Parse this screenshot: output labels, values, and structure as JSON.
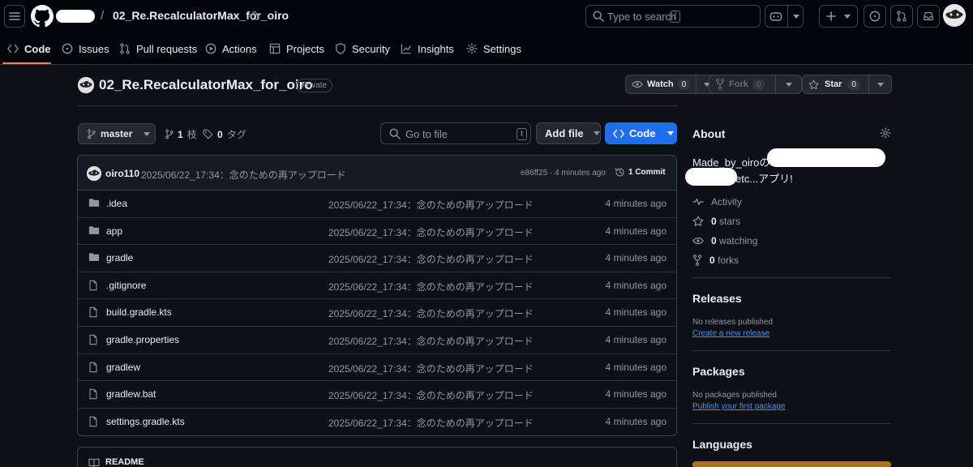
{
  "header": {
    "repo_crumb": "02_Re.RecalculatorMax_for_oiro",
    "separator": "/",
    "search_placeholder": "Type to search",
    "search_shortcut": "/"
  },
  "nav_tabs": [
    {
      "label": "Code",
      "icon": "code-icon",
      "active": true
    },
    {
      "label": "Issues",
      "icon": "issue-opened-icon"
    },
    {
      "label": "Pull requests",
      "icon": "git-pull-request-icon"
    },
    {
      "label": "Actions",
      "icon": "play-icon"
    },
    {
      "label": "Projects",
      "icon": "table-icon"
    },
    {
      "label": "Security",
      "icon": "shield-icon"
    },
    {
      "label": "Insights",
      "icon": "graph-icon"
    },
    {
      "label": "Settings",
      "icon": "gear-icon"
    }
  ],
  "repo": {
    "name": "02_Re.RecalculatorMax_for_oiro",
    "visibility": "Private",
    "watch": {
      "label": "Watch",
      "count": "0"
    },
    "fork": {
      "label": "Fork",
      "count": "0"
    },
    "star": {
      "label": "Star",
      "count": "0"
    }
  },
  "toolbar": {
    "branch": "master",
    "branches_count": "1",
    "branches_label": "枝",
    "tags_count": "0",
    "tags_label": "タグ",
    "goto_placeholder": "Go to file",
    "goto_shortcut": "t",
    "add_file": "Add file",
    "code": "Code"
  },
  "latest_commit": {
    "author": "oiro110",
    "message": "2025/06/22_17:34：念のための再アップロード",
    "hash_time": "e86ff25 · 4 minutes ago",
    "commits": "1 Commit"
  },
  "files": [
    {
      "name": ".idea",
      "type": "folder",
      "message": "2025/06/22_17:34：念のための再アップロード",
      "time": "4 minutes ago"
    },
    {
      "name": "app",
      "type": "folder",
      "message": "2025/06/22_17:34：念のための再アップロード",
      "time": "4 minutes ago"
    },
    {
      "name": "gradle",
      "type": "folder",
      "message": "2025/06/22_17:34：念のための再アップロード",
      "time": "4 minutes ago"
    },
    {
      "name": ".gitignore",
      "type": "file",
      "message": "2025/06/22_17:34：念のための再アップロード",
      "time": "4 minutes ago"
    },
    {
      "name": "build.gradle.kts",
      "type": "file",
      "message": "2025/06/22_17:34：念のための再アップロード",
      "time": "4 minutes ago"
    },
    {
      "name": "gradle.properties",
      "type": "file",
      "message": "2025/06/22_17:34：念のための再アップロード",
      "time": "4 minutes ago"
    },
    {
      "name": "gradlew",
      "type": "file",
      "message": "2025/06/22_17:34：念のための再アップロード",
      "time": "4 minutes ago"
    },
    {
      "name": "gradlew.bat",
      "type": "file",
      "message": "2025/06/22_17:34：念のための再アップロード",
      "time": "4 minutes ago"
    },
    {
      "name": "settings.gradle.kts",
      "type": "file",
      "message": "2025/06/22_17:34：念のための再アップロード",
      "time": "4 minutes ago"
    }
  ],
  "readme": {
    "label": "README"
  },
  "sidebar": {
    "about_title": "About",
    "description_start": "Made_by_oiroの",
    "description_end": "etc...アプリ!",
    "activity": "Activity",
    "stars_count": "0",
    "stars_label": "stars",
    "watching_count": "0",
    "watching_label": "watching",
    "forks_count": "0",
    "forks_label": "forks",
    "releases_title": "Releases",
    "releases_none": "No releases published",
    "releases_link": "Create a new release",
    "packages_title": "Packages",
    "packages_none": "No packages published",
    "packages_link": "Publish your first package",
    "languages_title": "Languages"
  },
  "colors": {
    "accent_blue": "#1f6feb",
    "active_tab_underline": "#f78166",
    "link": "#4493f8",
    "language_bar": "#b07219"
  }
}
